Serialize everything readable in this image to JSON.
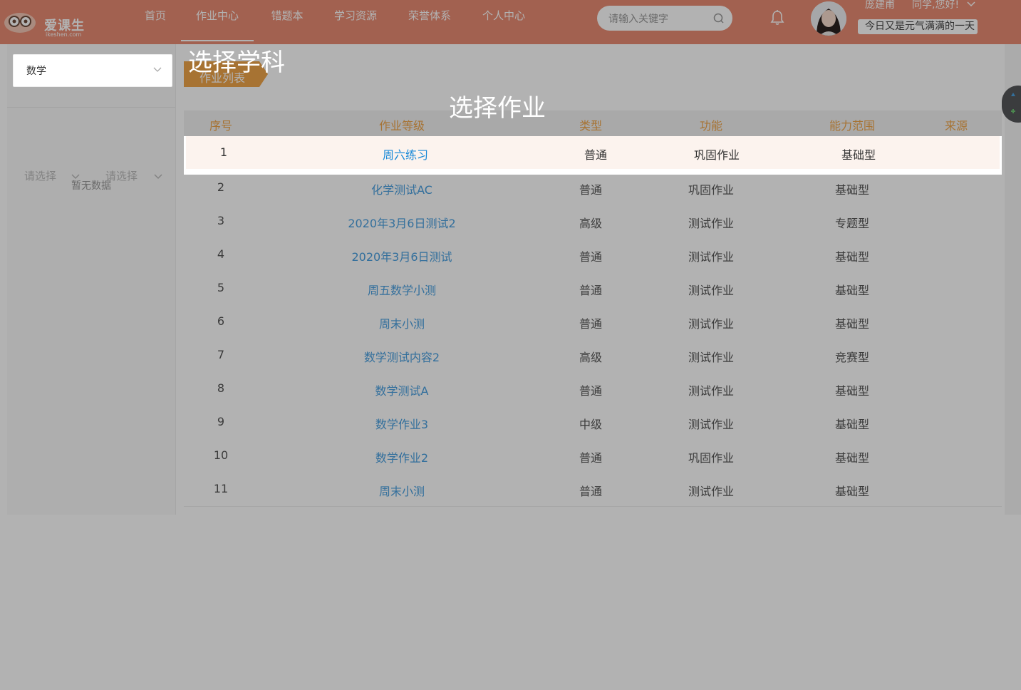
{
  "header": {
    "logo_text": "爱课生",
    "logo_sub": "ikeshen.com",
    "nav": [
      {
        "label": "首页"
      },
      {
        "label": "作业中心"
      },
      {
        "label": "错题本"
      },
      {
        "label": "学习资源"
      },
      {
        "label": "荣誉体系"
      },
      {
        "label": "个人中心"
      }
    ],
    "search_placeholder": "请输入关键字",
    "user_name": "庞建甫",
    "greeting": "同学,您好!",
    "motto": "今日又是元气满满的一天",
    "colors": {
      "bar": "#e98c73"
    }
  },
  "sidebar": {
    "subject": "数学",
    "filter1": "请选择",
    "filter2": "请选择",
    "empty": "暂无数据"
  },
  "main": {
    "section_tab": "作业列表",
    "columns": [
      "序号",
      "作业等级",
      "类型",
      "功能",
      "能力范围",
      "来源"
    ],
    "rows": [
      {
        "idx": "1",
        "name": "周六练习",
        "type": "普通",
        "func": "巩固作业",
        "range": "基础型",
        "source": ""
      },
      {
        "idx": "2",
        "name": "化学测试AC",
        "type": "普通",
        "func": "巩固作业",
        "range": "基础型",
        "source": ""
      },
      {
        "idx": "3",
        "name": "2020年3月6日测试2",
        "type": "高级",
        "func": "测试作业",
        "range": "专题型",
        "source": ""
      },
      {
        "idx": "4",
        "name": "2020年3月6日测试",
        "type": "普通",
        "func": "测试作业",
        "range": "基础型",
        "source": ""
      },
      {
        "idx": "5",
        "name": "周五数学小测",
        "type": "普通",
        "func": "测试作业",
        "range": "基础型",
        "source": ""
      },
      {
        "idx": "6",
        "name": "周末小测",
        "type": "普通",
        "func": "测试作业",
        "range": "基础型",
        "source": ""
      },
      {
        "idx": "7",
        "name": "数学测试内容2",
        "type": "高级",
        "func": "测试作业",
        "range": "竞赛型",
        "source": ""
      },
      {
        "idx": "8",
        "name": "数学测试A",
        "type": "普通",
        "func": "测试作业",
        "range": "基础型",
        "source": ""
      },
      {
        "idx": "9",
        "name": "数学作业3",
        "type": "中级",
        "func": "测试作业",
        "range": "基础型",
        "source": ""
      },
      {
        "idx": "10",
        "name": "数学作业2",
        "type": "普通",
        "func": "巩固作业",
        "range": "基础型",
        "source": ""
      },
      {
        "idx": "11",
        "name": "周末小测",
        "type": "普通",
        "func": "测试作业",
        "range": "基础型",
        "source": ""
      }
    ]
  },
  "guide": {
    "subject_label": "选择学科",
    "homework_label": "选择作业"
  }
}
